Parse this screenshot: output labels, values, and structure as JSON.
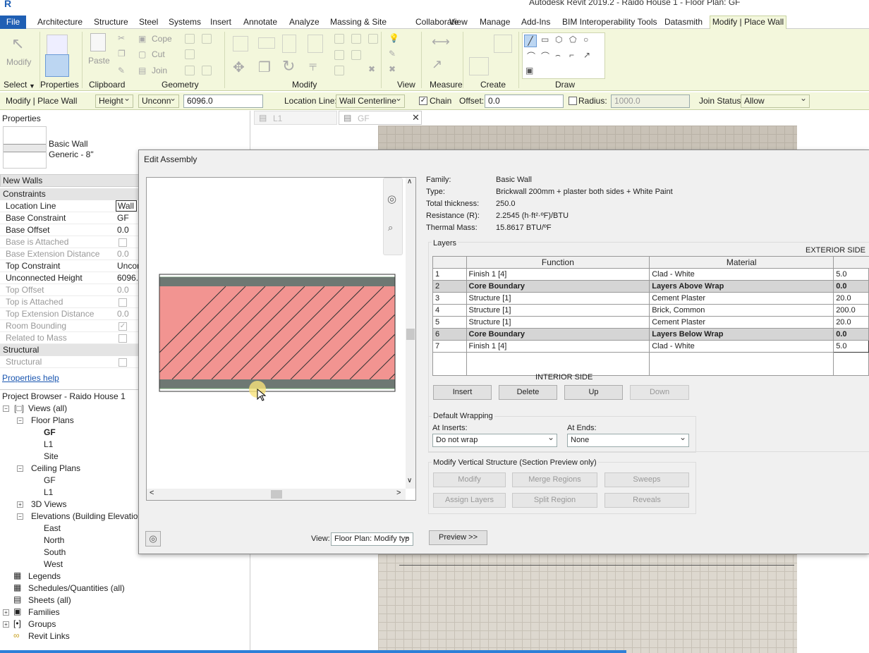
{
  "app": {
    "title": "Autodesk Revit 2019.2 - Raido House 1 - Floor Plan: GF"
  },
  "tabs": {
    "file": "File",
    "items": [
      "Architecture",
      "Structure",
      "Steel",
      "Systems",
      "Insert",
      "Annotate",
      "Analyze",
      "Massing & Site",
      "Collaborate",
      "View",
      "Manage",
      "Add-Ins",
      "BIM Interoperability Tools",
      "Datasmith"
    ],
    "active": "Modify | Place Wall"
  },
  "ribbon": {
    "groups": [
      "Select",
      "Properties",
      "Clipboard",
      "Geometry",
      "Modify",
      "View",
      "Measure",
      "Create",
      "Draw"
    ],
    "modify_label": "Modify",
    "paste_label": "Paste",
    "properties_label": "Properties",
    "cope_label": "Cope",
    "cut_label": "Cut",
    "join_label": "Join"
  },
  "options": {
    "context": "Modify | Place Wall",
    "height_mode": "Height",
    "height_target": "Unconn",
    "height_value": "6096.0",
    "location_line_label": "Location Line:",
    "location_line": "Wall Centerline",
    "chain_label": "Chain",
    "offset_label": "Offset:",
    "offset": "0.0",
    "radius_label": "Radius:",
    "radius": "1000.0",
    "join_status_label": "Join Status:",
    "join_status": "Allow"
  },
  "properties": {
    "header": "Properties",
    "type_name": "Basic Wall",
    "type_sub": "Generic - 8\"",
    "selector": "New Walls",
    "sections": {
      "constraints": "Constraints",
      "structural": "Structural"
    },
    "rows": [
      {
        "name": "Location Line",
        "value": "Wall C"
      },
      {
        "name": "Base Constraint",
        "value": "GF"
      },
      {
        "name": "Base Offset",
        "value": "0.0"
      },
      {
        "name": "Base is Attached",
        "value": ""
      },
      {
        "name": "Base Extension Distance",
        "value": "0.0"
      },
      {
        "name": "Top Constraint",
        "value": "Uncon"
      },
      {
        "name": "Unconnected Height",
        "value": "6096."
      },
      {
        "name": "Top Offset",
        "value": "0.0"
      },
      {
        "name": "Top is Attached",
        "value": ""
      },
      {
        "name": "Top Extension Distance",
        "value": "0.0"
      },
      {
        "name": "Room Bounding",
        "value": ""
      },
      {
        "name": "Related to Mass",
        "value": ""
      }
    ],
    "structural_row": "Structural",
    "help": "Properties help"
  },
  "browser": {
    "title": "Project Browser - Raido House 1",
    "views": "Views (all)",
    "floor_plans": "Floor Plans",
    "fp_items": [
      "GF",
      "L1",
      "Site"
    ],
    "ceiling_plans": "Ceiling Plans",
    "cp_items": [
      "GF",
      "L1"
    ],
    "views3d": "3D Views",
    "elevations": "Elevations (Building Elevation)",
    "el_items": [
      "East",
      "North",
      "South",
      "West"
    ],
    "legends": "Legends",
    "schedules": "Schedules/Quantities (all)",
    "sheets": "Sheets (all)",
    "families": "Families",
    "groups": "Groups",
    "links": "Revit Links"
  },
  "viewtabs": {
    "l1": "L1",
    "gf": "GF"
  },
  "dialog": {
    "title": "Edit Assembly",
    "family_label": "Family:",
    "family": "Basic Wall",
    "type_label": "Type:",
    "type": "Brickwall 200mm + plaster both sides + White Paint",
    "thickness_label": "Total thickness:",
    "thickness": "250.0",
    "resistance_label": "Resistance (R):",
    "resistance": "2.2545 (h·ft²·ºF)/BTU",
    "mass_label": "Thermal Mass:",
    "mass": "15.8617 BTU/ºF",
    "layers_label": "Layers",
    "exterior": "EXTERIOR SIDE",
    "interior": "INTERIOR SIDE",
    "headers": {
      "function": "Function",
      "material": "Material"
    },
    "layers": [
      {
        "n": "1",
        "function": "Finish 1 [4]",
        "material": "Clad - White",
        "thickness": "5.0"
      },
      {
        "n": "2",
        "function": "Core Boundary",
        "material": "Layers Above Wrap",
        "thickness": "0.0"
      },
      {
        "n": "3",
        "function": "Structure [1]",
        "material": "Cement Plaster",
        "thickness": "20.0"
      },
      {
        "n": "4",
        "function": "Structure [1]",
        "material": "Brick, Common",
        "thickness": "200.0"
      },
      {
        "n": "5",
        "function": "Structure [1]",
        "material": "Cement Plaster",
        "thickness": "20.0"
      },
      {
        "n": "6",
        "function": "Core Boundary",
        "material": "Layers Below Wrap",
        "thickness": "0.0"
      },
      {
        "n": "7",
        "function": "Finish 1 [4]",
        "material": "Clad - White",
        "thickness": "5.0"
      }
    ],
    "buttons": {
      "insert": "Insert",
      "delete": "Delete",
      "up": "Up",
      "down": "Down"
    },
    "wrapping": {
      "title": "Default Wrapping",
      "inserts_label": "At Inserts:",
      "inserts": "Do not wrap",
      "ends_label": "At Ends:",
      "ends": "None"
    },
    "vertical": {
      "title": "Modify Vertical Structure (Section Preview only)",
      "modify": "Modify",
      "merge": "Merge Regions",
      "sweeps": "Sweeps",
      "assign": "Assign Layers",
      "split": "Split Region",
      "reveals": "Reveals"
    },
    "view_label": "View:",
    "view_value": "Floor Plan: Modify typ",
    "preview": "Preview >>"
  },
  "colors": {
    "ribbon": "#f3f7dc",
    "brick": "#f29491",
    "core": "#6e7873",
    "file_tab": "#1f5fb4"
  }
}
